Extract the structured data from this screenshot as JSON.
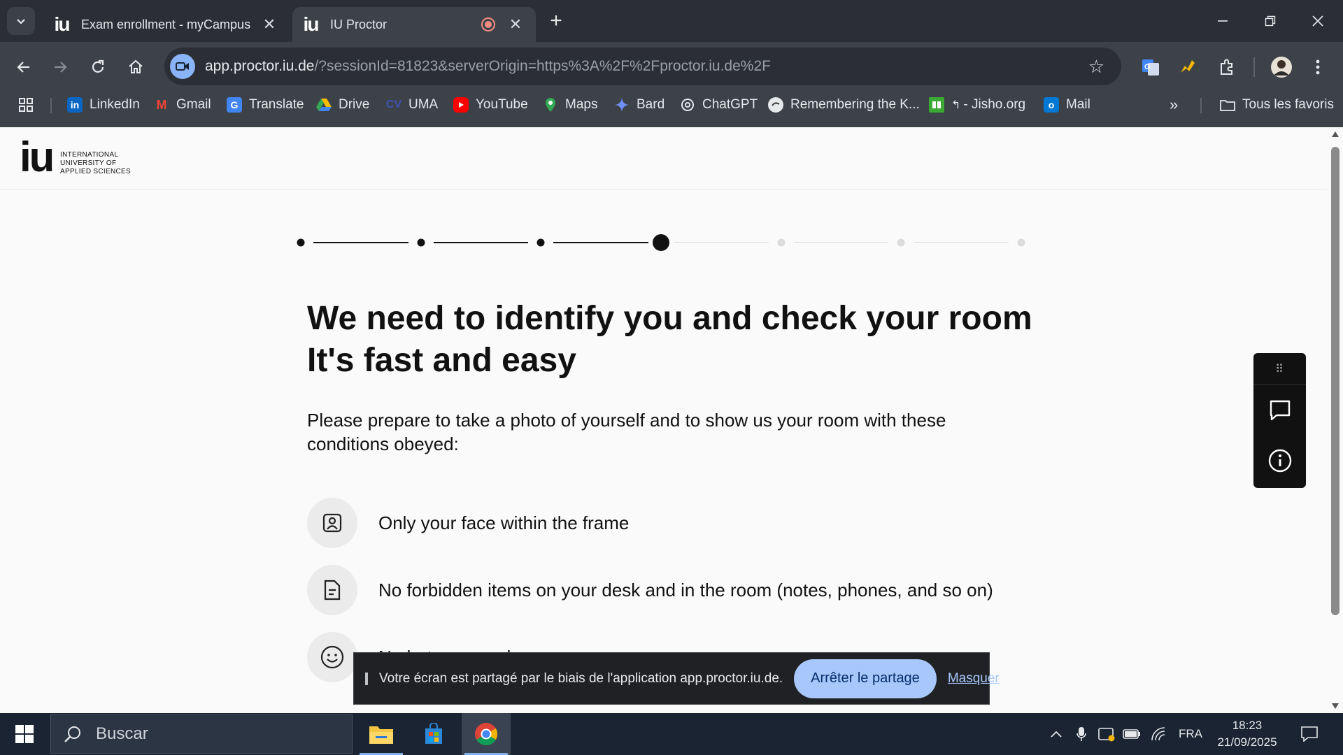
{
  "browser": {
    "tabs": [
      {
        "title": "Exam enrollment - myCampus",
        "favicon": "iu",
        "active": false
      },
      {
        "title": "IU Proctor",
        "favicon": "iu",
        "active": true,
        "recording": true
      }
    ],
    "url": {
      "host": "app.proctor.iu.de",
      "path": "/?sessionId=81823&serverOrigin=https%3A%2F%2Fproctor.iu.de%2F"
    },
    "bookmarks": [
      "LinkedIn",
      "Gmail",
      "Translate",
      "Drive",
      "UMA",
      "YouTube",
      "Maps",
      "Bard",
      "ChatGPT",
      "Remembering the K...",
      "- Jisho.org",
      "Mail"
    ],
    "all_bookmarks_label": "Tous les favoris"
  },
  "page": {
    "logo": {
      "mark": "iu",
      "line1": "INTERNATIONAL",
      "line2": "UNIVERSITY OF",
      "line3": "APPLIED SCIENCES"
    },
    "stepper": {
      "total_steps": 7,
      "current_step": 4
    },
    "heading_line1": "We need to identify you and check your room",
    "heading_line2": "It's fast and easy",
    "intro": "Please prepare to take a photo of yourself and to show us your room with these conditions obeyed:",
    "conditions": [
      {
        "icon": "face-frame-icon",
        "text": "Only your face within the frame"
      },
      {
        "icon": "document-icon",
        "text": "No forbidden items on your desk and in the room (notes, phones, and so on)"
      },
      {
        "icon": "smiley-icon",
        "text": "No hats or sunglasses"
      }
    ]
  },
  "sharebar": {
    "message": "Votre écran est partagé par le biais de l'application app.proctor.iu.de.",
    "stop_label": "Arrêter le partage",
    "hide_label": "Masquer"
  },
  "taskbar": {
    "search_placeholder": "Buscar",
    "language": "FRA",
    "time": "18:23",
    "date": "21/09/2025"
  },
  "colors": {
    "accent_blue": "#a8c7fa",
    "text_dark": "#111111",
    "chrome_dark": "#2b2f35",
    "chrome_toolbar": "#3d4249",
    "taskbar": "#1b2433"
  }
}
